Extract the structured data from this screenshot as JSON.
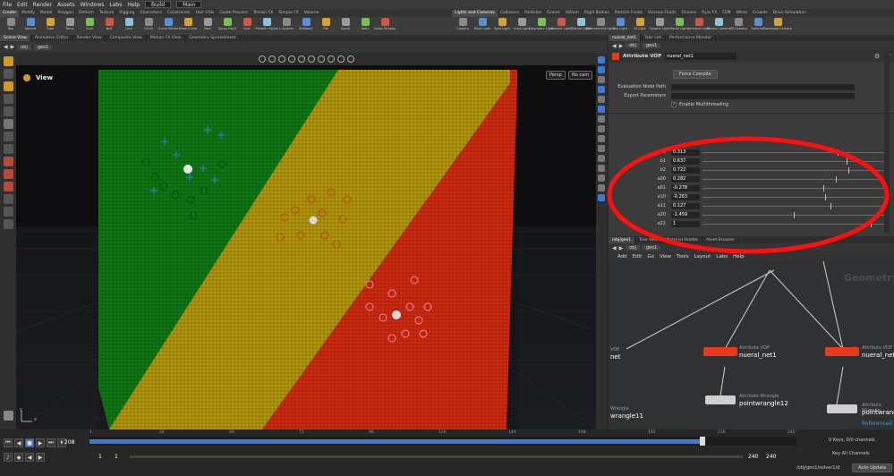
{
  "menubar": {
    "items": [
      "File",
      "Edit",
      "Render",
      "Assets",
      "Windows",
      "Labs",
      "Help"
    ],
    "build": "Build",
    "desktop": "Main"
  },
  "shelf_left": {
    "tabs": [
      "Create",
      "Modify",
      "Model",
      "Polygon",
      "Deform",
      "Texture",
      "Rigging",
      "Characters",
      "Constraints",
      "Hair Utils",
      "Guide Process",
      "Terrain FX",
      "Simple FX",
      "Volume"
    ],
    "tools": [
      "Box",
      "Sphere",
      "Tube",
      "Torus",
      "Grid",
      "Null",
      "Line",
      "Circle",
      "Curve Bezier",
      "Draw Curve",
      "Path",
      "Spray Paint",
      "Font",
      "Platonic Solids",
      "L-System",
      "Metaball",
      "File",
      "Spiral",
      "Helix",
      "Quick Shapes"
    ]
  },
  "shelf_right": {
    "tabs": [
      "Lights and Cameras",
      "Collisions",
      "Particles",
      "Grains",
      "Vellum",
      "Rigid Bodies",
      "Particle Fluids",
      "Viscous Fluids",
      "Oceans",
      "Pyro FX",
      "FEM",
      "Wires",
      "Crowds",
      "Drive Simulation"
    ],
    "tools": [
      "Camera",
      "Point Light",
      "Spot Light",
      "Area Light",
      "Geometry Light",
      "Volume Light",
      "Distant Light",
      "Environment Light",
      "Sky Light",
      "GI Light",
      "Caustic Light",
      "Portal Light",
      "Ambient Light",
      "Stereo Camera",
      "VR Camera",
      "Switcher",
      "Gamepad Camera"
    ]
  },
  "left_pane": {
    "tabs": [
      "Scene View",
      "Animation Editor",
      "Render View",
      "Composite View",
      "Motion FX View",
      "Geometry Spreadsheet"
    ],
    "path": "obj",
    "node": "geo1",
    "view_label": "View",
    "persp": "Persp",
    "cam": "No cam",
    "axis_y": "y",
    "axis_x": "x"
  },
  "param_pane": {
    "tabs": [
      "nueral_net1",
      "Take List",
      "Performance Monitor"
    ],
    "path": "obj",
    "node": "geo1",
    "type": "Attribute VOP",
    "name": "nueral_net1",
    "force_compile": "Force Compile",
    "eval_label": "Evaluation Node Path",
    "export_label": "Export Parameters",
    "multithread_label": "Enable Multithreading",
    "params": [
      {
        "label": "b0",
        "value": "0.313",
        "frac": 0.74
      },
      {
        "label": "b1",
        "value": "0.637",
        "frac": 0.79
      },
      {
        "label": "b2",
        "value": "0.722",
        "frac": 0.8
      },
      {
        "label": "a00",
        "value": "0.282",
        "frac": 0.73
      },
      {
        "label": "a01",
        "value": "-0.278",
        "frac": 0.66
      },
      {
        "label": "a10",
        "value": "-0.263",
        "frac": 0.67
      },
      {
        "label": "a11",
        "value": "0.127",
        "frac": 0.7
      },
      {
        "label": "a20",
        "value": "-1.459",
        "frac": 0.5
      },
      {
        "label": "a21",
        "value": "1",
        "frac": 0.92
      }
    ]
  },
  "net_pane": {
    "tabs": [
      "/obj/geo1",
      "Tree View",
      "Material Palette",
      "Asset Browser"
    ],
    "menu": [
      "Add",
      "Edit",
      "Go",
      "View",
      "Tools",
      "Layout",
      "Labs",
      "Help"
    ],
    "path": "obj",
    "node": "geo1",
    "watermark": "Geometry",
    "nodes": [
      {
        "type": "Attribute VOP",
        "name": "nueral_net1",
        "color": "#e8381f"
      },
      {
        "type": "Attribute VOP",
        "name": "nueral_net",
        "color": "#e8381f"
      },
      {
        "type": "Attribute Wrangle",
        "name": "pointwrangle12",
        "color": "#cfcfcf"
      },
      {
        "type": "Attribute Wrangle",
        "name": "pointwrang",
        "color": "#cfcfcf"
      },
      {
        "type": "Wrangle",
        "name": "wrangle11",
        "color": "#cfcfcf"
      },
      {
        "type": "VOP",
        "name": "net",
        "color": "#e8381f"
      }
    ],
    "referenced": "Referenced"
  },
  "timeline": {
    "frame": "208",
    "ticks": [
      "1",
      "24",
      "48",
      "72",
      "96",
      "120",
      "144",
      "168",
      "192",
      "216",
      "240"
    ],
    "range_start": "1",
    "range_start2": "1",
    "range_end": "240",
    "range_end2": "240",
    "keys_label": "0 Keys, 0/0 channels",
    "key_all": "Key All Channels",
    "status_path": "/obj/geo1/solver1/d",
    "auto_update": "Auto Update"
  },
  "colors": {
    "green": "#0f7a14",
    "yellow": "#b79a0b",
    "red": "#d42b10",
    "accent_blue": "#3b7ad8",
    "node_red": "#e8381f",
    "annotation_red": "#ff1010"
  }
}
